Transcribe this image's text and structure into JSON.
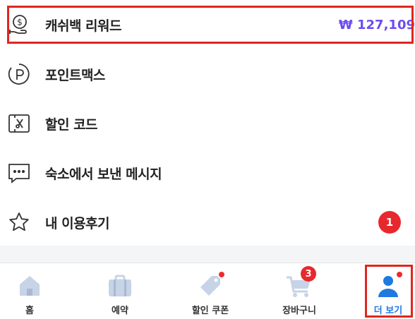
{
  "menu": {
    "items": [
      {
        "icon": "cashback-coin-icon",
        "label": "캐쉬백 리워드",
        "value": "₩ 127,109"
      },
      {
        "icon": "point-max-icon",
        "label": "포인트맥스"
      },
      {
        "icon": "discount-code-icon",
        "label": "할인 코드"
      },
      {
        "icon": "message-icon",
        "label": "숙소에서 보낸 메시지"
      },
      {
        "icon": "star-icon",
        "label": "내 이용후기",
        "badge": "1"
      }
    ]
  },
  "tabbar": {
    "tabs": [
      {
        "icon": "home-icon",
        "label": "홈"
      },
      {
        "icon": "briefcase-icon",
        "label": "예약"
      },
      {
        "icon": "tag-icon",
        "label": "할인 쿠폰",
        "dot": true
      },
      {
        "icon": "cart-icon",
        "label": "장바구니",
        "badge": "3"
      },
      {
        "icon": "person-icon",
        "label": "더 보기",
        "dot": true,
        "active": true
      }
    ]
  },
  "colors": {
    "accent": "#6c4cf1",
    "badge": "#e8282d",
    "highlight": "#e0261f",
    "active_tab": "#1f7ae0",
    "inactive_icon": "#c7d3e6"
  }
}
